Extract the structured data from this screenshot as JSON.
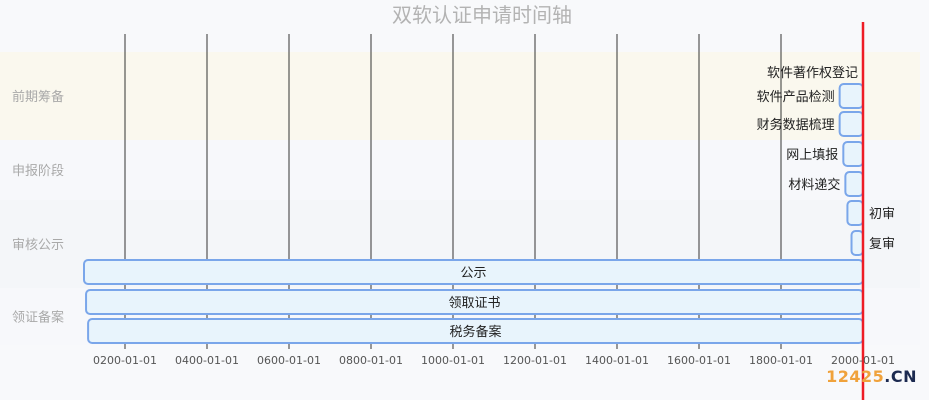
{
  "chart_data": {
    "type": "gantt",
    "title": "双软认证申请时间轴",
    "x_axis": {
      "min": "0100-01-01",
      "max": "2000-01-01",
      "ticks": [
        "0200-01-01",
        "0400-01-01",
        "0600-01-01",
        "0800-01-01",
        "1000-01-01",
        "1200-01-01",
        "1400-01-01",
        "1600-01-01",
        "1800-01-01",
        "2000-01-01"
      ],
      "grid": true
    },
    "today_marker": "2000-01-01",
    "sections": [
      {
        "name": "前期筹备",
        "color": "#faf8ee"
      },
      {
        "name": "申报阶段",
        "color": "#f7f8fb"
      },
      {
        "name": "审核公示",
        "color": "#f4f6f9"
      },
      {
        "name": "领证备案",
        "color": "#f7f8fb"
      }
    ],
    "tasks": [
      {
        "name": "软件著作权登记",
        "section": "前期筹备",
        "start": "2000-01-01",
        "end": "2000-01-01"
      },
      {
        "name": "软件产品检测",
        "section": "前期筹备",
        "start": "1943-01-01",
        "end": "2000-01-01"
      },
      {
        "name": "财务数据梳理",
        "section": "前期筹备",
        "start": "1943-01-01",
        "end": "2000-01-01"
      },
      {
        "name": "网上填报",
        "section": "申报阶段",
        "start": "1952-01-01",
        "end": "2000-01-01"
      },
      {
        "name": "材料递交",
        "section": "申报阶段",
        "start": "1957-01-01",
        "end": "2000-01-01"
      },
      {
        "name": "初审",
        "section": "审核公示",
        "start": "1962-01-01",
        "end": "2000-01-01"
      },
      {
        "name": "复审",
        "section": "审核公示",
        "start": "1972-01-01",
        "end": "2000-01-01"
      },
      {
        "name": "公示",
        "section": "审核公示",
        "start": "0100-01-01",
        "end": "2000-01-01"
      },
      {
        "name": "领取证书",
        "section": "领证备案",
        "start": "0105-01-01",
        "end": "2000-01-01"
      },
      {
        "name": "税务备案",
        "section": "领证备案",
        "start": "0110-01-01",
        "end": "2000-01-01"
      }
    ]
  },
  "colors": {
    "bar_fill": "#e8f4fc",
    "bar_stroke": "#7aa6ea",
    "today_line": "#ee1c25",
    "grid": "#333333",
    "section_label": "#a9a9a9",
    "tick_label": "#555555",
    "title": "#b3b3b3"
  },
  "watermark": {
    "digits": "12425",
    "suffix": ".CN"
  }
}
